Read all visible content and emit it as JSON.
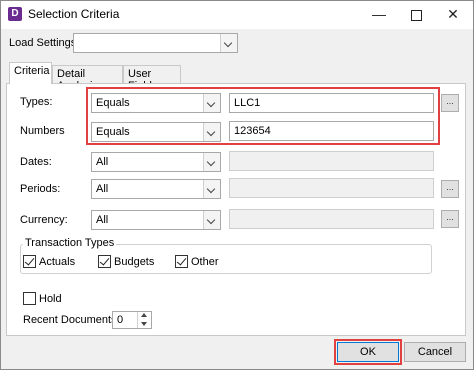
{
  "window": {
    "title": "Selection Criteria",
    "icon_letter": "D"
  },
  "load_settings": {
    "label": "Load Settings:",
    "value": ""
  },
  "tabs": [
    {
      "label": "Criteria",
      "active": true
    },
    {
      "label": "Detail Analysis",
      "active": false
    },
    {
      "label": "User Fields",
      "active": false
    }
  ],
  "criteria": {
    "types": {
      "label": "Types:",
      "operator": "Equals",
      "value": "LLC1"
    },
    "numbers": {
      "label": "Numbers",
      "operator": "Equals",
      "value": "123654"
    },
    "dates": {
      "label": "Dates:",
      "operator": "All",
      "value": ""
    },
    "periods": {
      "label": "Periods:",
      "operator": "All",
      "value": ""
    },
    "currency": {
      "label": "Currency:",
      "operator": "All",
      "value": ""
    }
  },
  "transaction_types": {
    "title": "Transaction Types",
    "actuals": {
      "label": "Actuals",
      "checked": true
    },
    "budgets": {
      "label": "Budgets",
      "checked": true
    },
    "other": {
      "label": "Other",
      "checked": true
    }
  },
  "hold": {
    "label": "Hold",
    "checked": false
  },
  "recent_documents": {
    "label": "Recent Documents:",
    "value": "0"
  },
  "buttons": {
    "ok": "OK",
    "cancel": "Cancel",
    "ellipsis": "..."
  },
  "colors": {
    "highlight": "#e04040",
    "app_icon": "#6b2c91"
  }
}
